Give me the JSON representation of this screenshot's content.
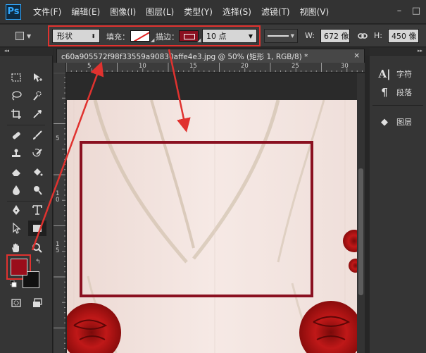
{
  "app": {
    "logo": "Ps"
  },
  "menu": [
    "文件(F)",
    "编辑(E)",
    "图像(I)",
    "图层(L)",
    "类型(Y)",
    "选择(S)",
    "滤镜(T)",
    "视图(V)"
  ],
  "window_controls": {
    "minimize": "–",
    "maximize": "□"
  },
  "options": {
    "mode": "形状",
    "fill_label": "填充：",
    "stroke_label": "描边：",
    "stroke_width": "10 点",
    "width_label": "W:",
    "width_value": "672 像",
    "height_label": "H:",
    "height_value": "450 像"
  },
  "document": {
    "tab_title": "c60a905572f98f33559a90830affe4e3.jpg @ 50% (矩形 1, RGB/8) *",
    "close": "×",
    "ruler_top_labels": [
      "5",
      "10",
      "15",
      "20",
      "25",
      "30"
    ],
    "ruler_left_labels": [
      "5",
      "1\n0",
      "1\n5"
    ]
  },
  "colors": {
    "foreground": "#9a0d1b",
    "background": "#111111",
    "annotation_red": "#e0322f",
    "rect_stroke": "#8a1020"
  },
  "panels": [
    {
      "icon": "character-icon",
      "glyph": "A|",
      "label": "字符"
    },
    {
      "icon": "paragraph-icon",
      "glyph": "¶",
      "label": "段落"
    },
    {
      "icon": "layers-icon",
      "glyph": "◆",
      "label": "图层"
    }
  ]
}
